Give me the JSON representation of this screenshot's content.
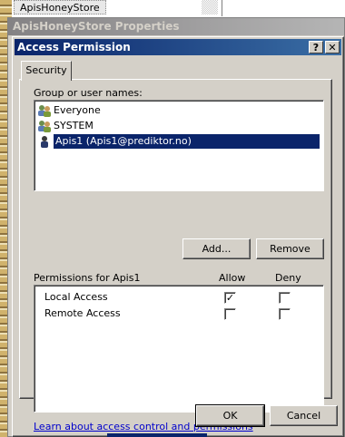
{
  "background": {
    "tree_item": "ApisHoneyStore"
  },
  "parent_window": {
    "title": "ApisHoneyStore Properties"
  },
  "dialog": {
    "title": "Access Permission",
    "help_button": "?",
    "close_button": "✕",
    "tabs": [
      {
        "label": "Security"
      }
    ],
    "group_label": "Group or user names:",
    "users": [
      {
        "name": "Everyone",
        "icon": "group-icon"
      },
      {
        "name": "SYSTEM",
        "icon": "group-icon"
      },
      {
        "name": "Apis1 (Apis1@prediktor.no)",
        "icon": "user-icon",
        "selected": true
      }
    ],
    "add_button": "Add...",
    "remove_button": "Remove",
    "permissions_label": "Permissions for Apis1",
    "allow_header": "Allow",
    "deny_header": "Deny",
    "permissions": [
      {
        "name": "Local Access",
        "allow": true,
        "deny": false
      },
      {
        "name": "Remote Access",
        "allow": false,
        "deny": false
      }
    ],
    "learn_link": "Learn about access control and permissions",
    "ok_button": "OK",
    "cancel_button": "Cancel"
  },
  "colors": {
    "title_active": "#0a246a",
    "face": "#d4d0c8",
    "selection": "#0a246a"
  }
}
